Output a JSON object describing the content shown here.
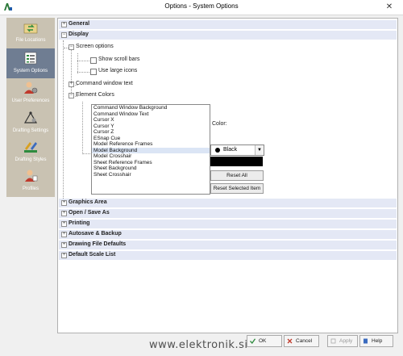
{
  "window": {
    "title": "Options - System Options"
  },
  "sidebar": {
    "items": [
      {
        "label": "File Locations",
        "icon": "folder-sync-icon",
        "active": false
      },
      {
        "label": "System Options",
        "icon": "list-settings-icon",
        "active": true
      },
      {
        "label": "User Preferences",
        "icon": "user-gear-icon",
        "active": false
      },
      {
        "label": "Drafting Settings",
        "icon": "drafting-tools-icon",
        "active": false
      },
      {
        "label": "Drafting Styles",
        "icon": "styles-palette-icon",
        "active": false
      },
      {
        "label": "Profiles",
        "icon": "profile-user-icon",
        "active": false
      }
    ]
  },
  "tree": {
    "general": "General",
    "display": "Display",
    "screen_options": "Screen options",
    "show_scroll_bars": "Show scroll bars",
    "use_large_icons": "Use large icons",
    "command_window_text": "Command window text",
    "element_colors": "Element Colors",
    "color_label": "Color:",
    "color_value": "Black",
    "reset_all": "Reset All",
    "reset_selected": "Reset Selected Item",
    "element_list": [
      "Command Window Background",
      "Command Window Text",
      "Cursor X",
      "Cursor Y",
      "Cursor Z",
      "ESnap Cue",
      "Model Reference Frames",
      "Model Background",
      "Model Crosshair",
      "Sheet Reference Frames",
      "Sheet Background",
      "Sheet Crosshair"
    ],
    "selected_index": 7,
    "collapsed_sections": [
      "Graphics Area",
      "Open / Save As",
      "Printing",
      "Autosave & Backup",
      "Drawing File Defaults",
      "Default Scale List"
    ]
  },
  "footer": {
    "ok": "OK",
    "cancel": "Cancel",
    "apply": "Apply",
    "help": "Help"
  },
  "watermark": "www.elektronik.si",
  "colors": {
    "active_nav": "#6f7d92",
    "sidebar": "#c9c2b2",
    "section_band": "#e4e8f5"
  }
}
